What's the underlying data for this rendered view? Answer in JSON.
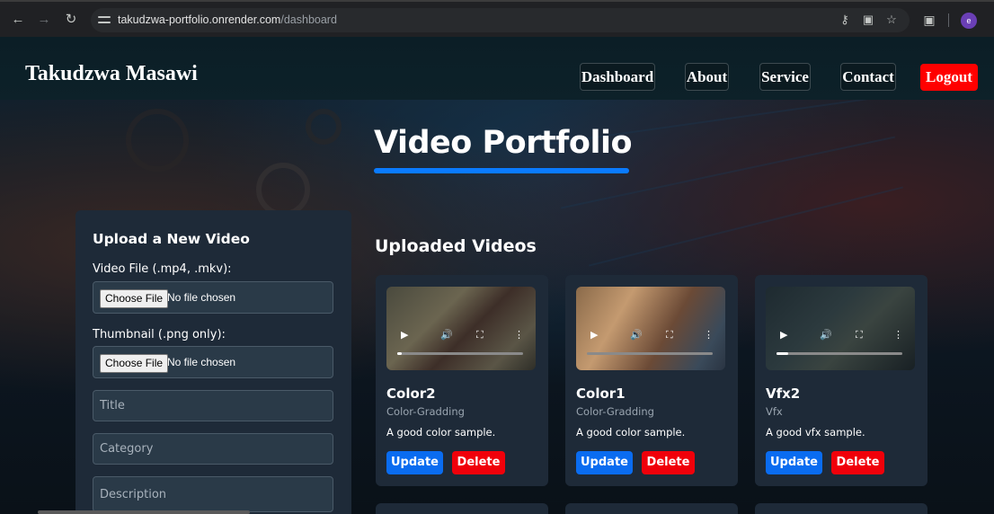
{
  "browser": {
    "url_host": "takudzwa-portfolio.onrender.com",
    "url_path": "/dashboard",
    "profile_initial": "e"
  },
  "header": {
    "brand": "Takudzwa Masawi",
    "nav": [
      "Dashboard",
      "About",
      "Service",
      "Contact"
    ],
    "logout": "Logout"
  },
  "page": {
    "title": "Video Portfolio",
    "accent_color": "#0a7bff"
  },
  "upload": {
    "heading": "Upload a New Video",
    "video_label": "Video File (.mp4, .mkv):",
    "thumbnail_label": "Thumbnail (.png only):",
    "choose_file": "Choose File",
    "no_file": "No file chosen",
    "title_placeholder": "Title",
    "category_placeholder": "Category",
    "description_placeholder": "Description"
  },
  "videos": {
    "heading": "Uploaded Videos",
    "update_label": "Update",
    "delete_label": "Delete",
    "items": [
      {
        "title": "Color2",
        "category": "Color-Gradding",
        "description": "A good color sample.",
        "progress": 0.03
      },
      {
        "title": "Color1",
        "category": "Color-Gradding",
        "description": "A good color sample.",
        "progress": 0.0
      },
      {
        "title": "Vfx2",
        "category": "Vfx",
        "description": "A good vfx sample.",
        "progress": 0.09
      }
    ]
  }
}
